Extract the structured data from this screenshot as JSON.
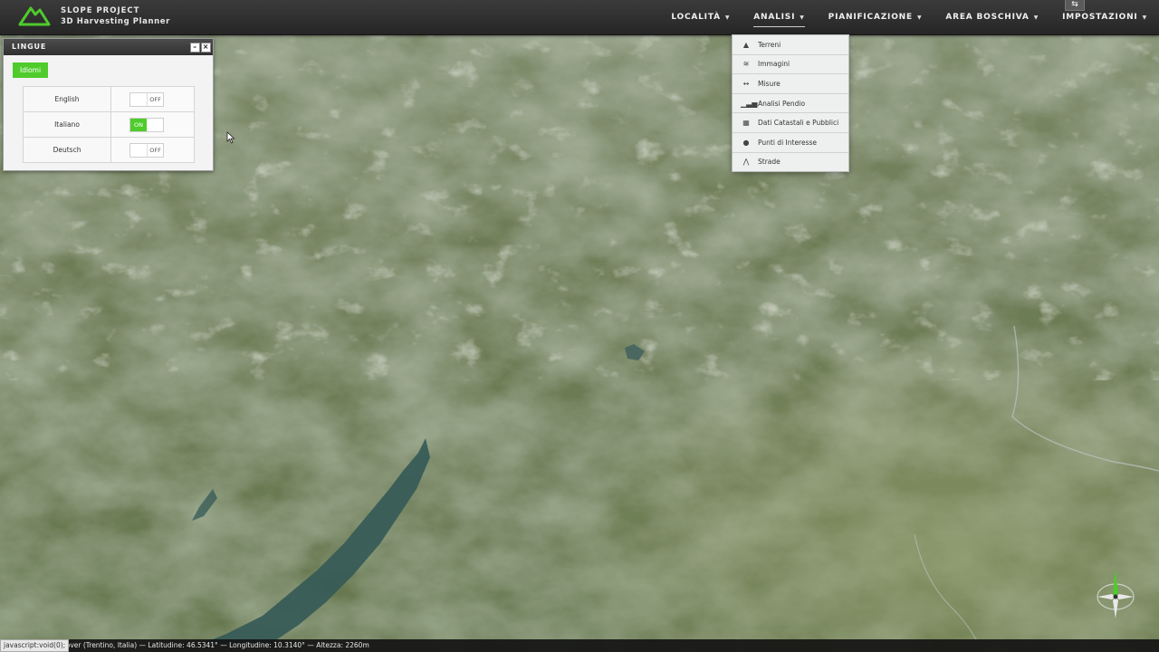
{
  "app": {
    "brand_line1": "SLOPE PROJECT",
    "brand_line2": "3D Harvesting Planner",
    "logo_icon": "mountain-logo-icon",
    "accent_color": "#4fcb2c"
  },
  "nav": {
    "items": [
      {
        "label": "LOCALITÀ",
        "active": false
      },
      {
        "label": "ANALISI",
        "active": true
      },
      {
        "label": "PIANIFICAZIONE",
        "active": false
      },
      {
        "label": "AREA BOSCHIVA",
        "active": false
      },
      {
        "label": "IMPOSTAZIONI",
        "active": false
      }
    ],
    "fullscreen_icon": "swap-arrows-icon"
  },
  "analisi_menu": {
    "items": [
      {
        "label": "Terreni",
        "icon": "mountain-icon"
      },
      {
        "label": "Immagini",
        "icon": "layers-icon"
      },
      {
        "label": "Misure",
        "icon": "measure-arrows-icon"
      },
      {
        "label": "Analisi Pendio",
        "icon": "bar-chart-icon"
      },
      {
        "label": "Dati Catastali e Pubblici",
        "icon": "grid-icon"
      },
      {
        "label": "Punti di Interesse",
        "icon": "map-pin-icon"
      },
      {
        "label": "Strade",
        "icon": "road-icon"
      }
    ]
  },
  "lingue_panel": {
    "title": "LINGUE",
    "tab": "Idiomi",
    "languages": [
      {
        "name": "English",
        "state": "OFF",
        "on": false
      },
      {
        "name": "Italiano",
        "state": "ON",
        "on": true
      },
      {
        "name": "Deutsch",
        "state": "OFF",
        "on": false
      }
    ]
  },
  "status": {
    "url": "javascript:void(0);",
    "location": "Sover (Trentino, Italia)",
    "lat_label": "Latitudine:",
    "lat_value": "46.5341°",
    "lon_label": "Longitudine:",
    "lon_value": "10.3140°",
    "alt_label": "Altezza:",
    "alt_value": "2260m"
  }
}
